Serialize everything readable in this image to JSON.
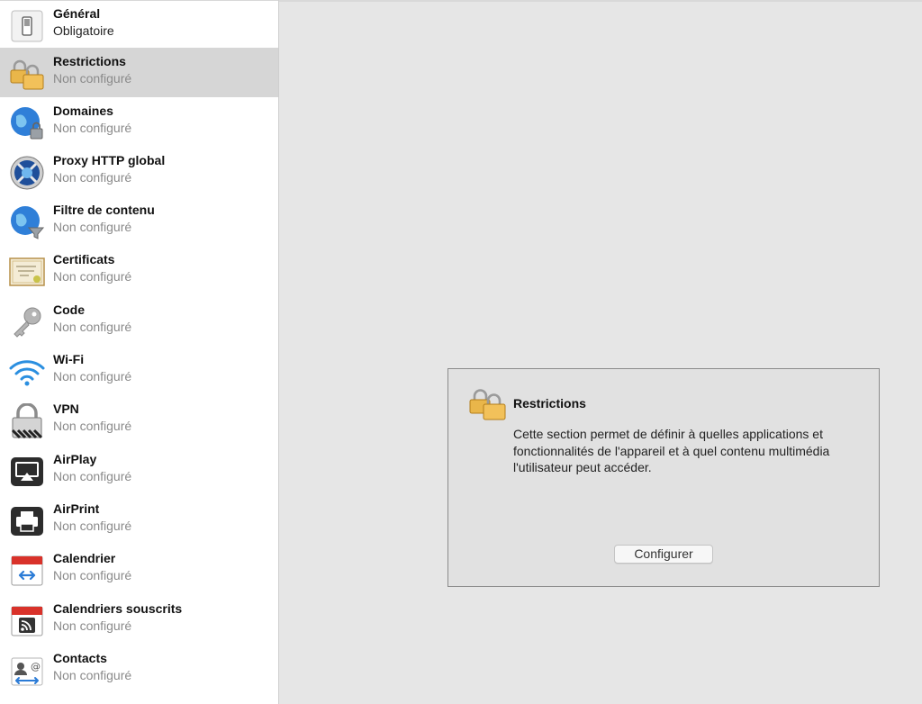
{
  "sidebar": {
    "items": [
      {
        "title": "Général",
        "status": "Obligatoire",
        "icon": "general-switch-icon"
      },
      {
        "title": "Restrictions",
        "status": "Non configuré",
        "icon": "padlocks-icon"
      },
      {
        "title": "Domaines",
        "status": "Non configuré",
        "icon": "globe-lock-icon"
      },
      {
        "title": "Proxy HTTP global",
        "status": "Non configuré",
        "icon": "proxy-globe-icon"
      },
      {
        "title": "Filtre de contenu",
        "status": "Non configuré",
        "icon": "globe-filter-icon"
      },
      {
        "title": "Certificats",
        "status": "Non configuré",
        "icon": "certificate-icon"
      },
      {
        "title": "Code",
        "status": "Non configuré",
        "icon": "key-icon"
      },
      {
        "title": "Wi-Fi",
        "status": "Non configuré",
        "icon": "wifi-icon"
      },
      {
        "title": "VPN",
        "status": "Non configuré",
        "icon": "vpn-lock-icon"
      },
      {
        "title": "AirPlay",
        "status": "Non configuré",
        "icon": "airplay-icon"
      },
      {
        "title": "AirPrint",
        "status": "Non configuré",
        "icon": "printer-icon"
      },
      {
        "title": "Calendrier",
        "status": "Non configuré",
        "icon": "calendar-icon"
      },
      {
        "title": "Calendriers souscrits",
        "status": "Non configuré",
        "icon": "subscribed-calendar-icon"
      },
      {
        "title": "Contacts",
        "status": "Non configuré",
        "icon": "contacts-icon"
      }
    ]
  },
  "panel": {
    "icon": "padlocks-icon",
    "title": "Restrictions",
    "description": "Cette section permet de définir à quelles applications et fonctionnalités de l'appareil et à quel contenu multimédia l'utilisateur peut accéder.",
    "button_label": "Configurer"
  },
  "colors": {
    "selected_row": "#d6d6d6",
    "sidebar_bg": "#ffffff",
    "main_bg": "#e6e6e6",
    "status_text": "#8a8a8a"
  }
}
